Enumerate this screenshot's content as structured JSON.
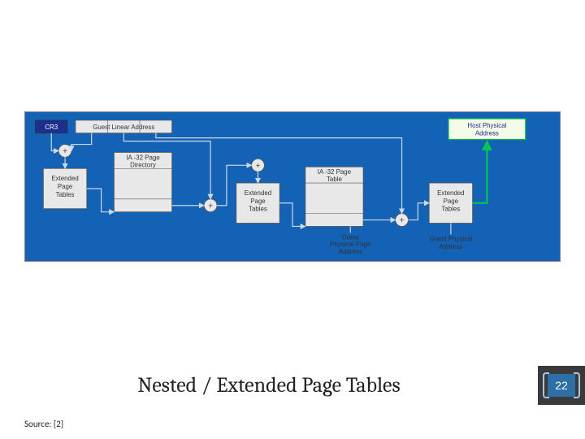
{
  "slide": {
    "title": "Nested / Extended Page Tables",
    "page_number": "22",
    "source": "Source: [2]"
  },
  "diagram": {
    "labels": {
      "cr3": "CR3",
      "guest_linear": "Guest Linear Address",
      "host_physical_1": "Host Physical",
      "host_physical_2": "Address",
      "ept_1": "Extended",
      "ept_2": "Page",
      "ept_3": "Tables",
      "ia32_dir_1": "IA -32 Page",
      "ia32_dir_2": "Directory",
      "ia32_tbl_1": "IA -32 Page",
      "ia32_tbl_2": "Table",
      "guest_phys_page_1": "Guest",
      "guest_phys_page_2": "Physical Page",
      "guest_phys_page_3": "Address",
      "guest_phys_1": "Guest Physical",
      "guest_phys_2": "Address"
    }
  }
}
